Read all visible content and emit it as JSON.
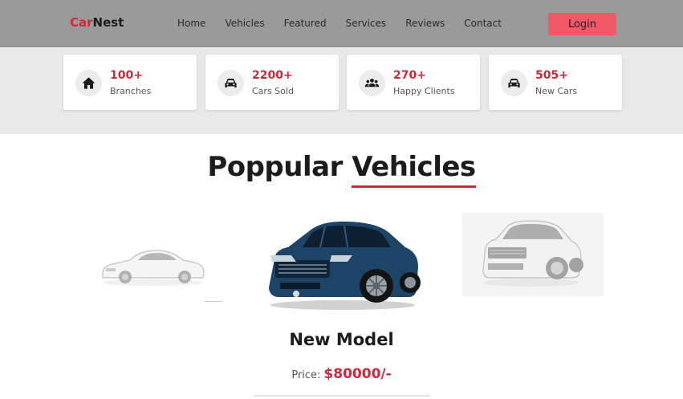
{
  "header": {
    "brand_part1": "Car",
    "brand_part2": "Nest",
    "nav": [
      "Home",
      "Vehicles",
      "Featured",
      "Services",
      "Reviews",
      "Contact"
    ],
    "login_label": "Login"
  },
  "stats": [
    {
      "value": "100+",
      "label": "Branches",
      "icon": "home-icon"
    },
    {
      "value": "2200+",
      "label": "Cars Sold",
      "icon": "car-icon"
    },
    {
      "value": "270+",
      "label": "Happy Clients",
      "icon": "users-icon"
    },
    {
      "value": "505+",
      "label": "New Cars",
      "icon": "car-icon"
    }
  ],
  "section": {
    "title_part1": "Poppular",
    "title_part2": "Vehicles"
  },
  "featured": {
    "model": "New Model",
    "price_label": "Price:",
    "price_value": "$80000/-"
  },
  "colors": {
    "accent": "#d0283a",
    "header_bg": "#9a9a9a",
    "login_bg": "#f25866",
    "stats_bg": "#e9e9e9",
    "center_car": "#1d4466"
  }
}
